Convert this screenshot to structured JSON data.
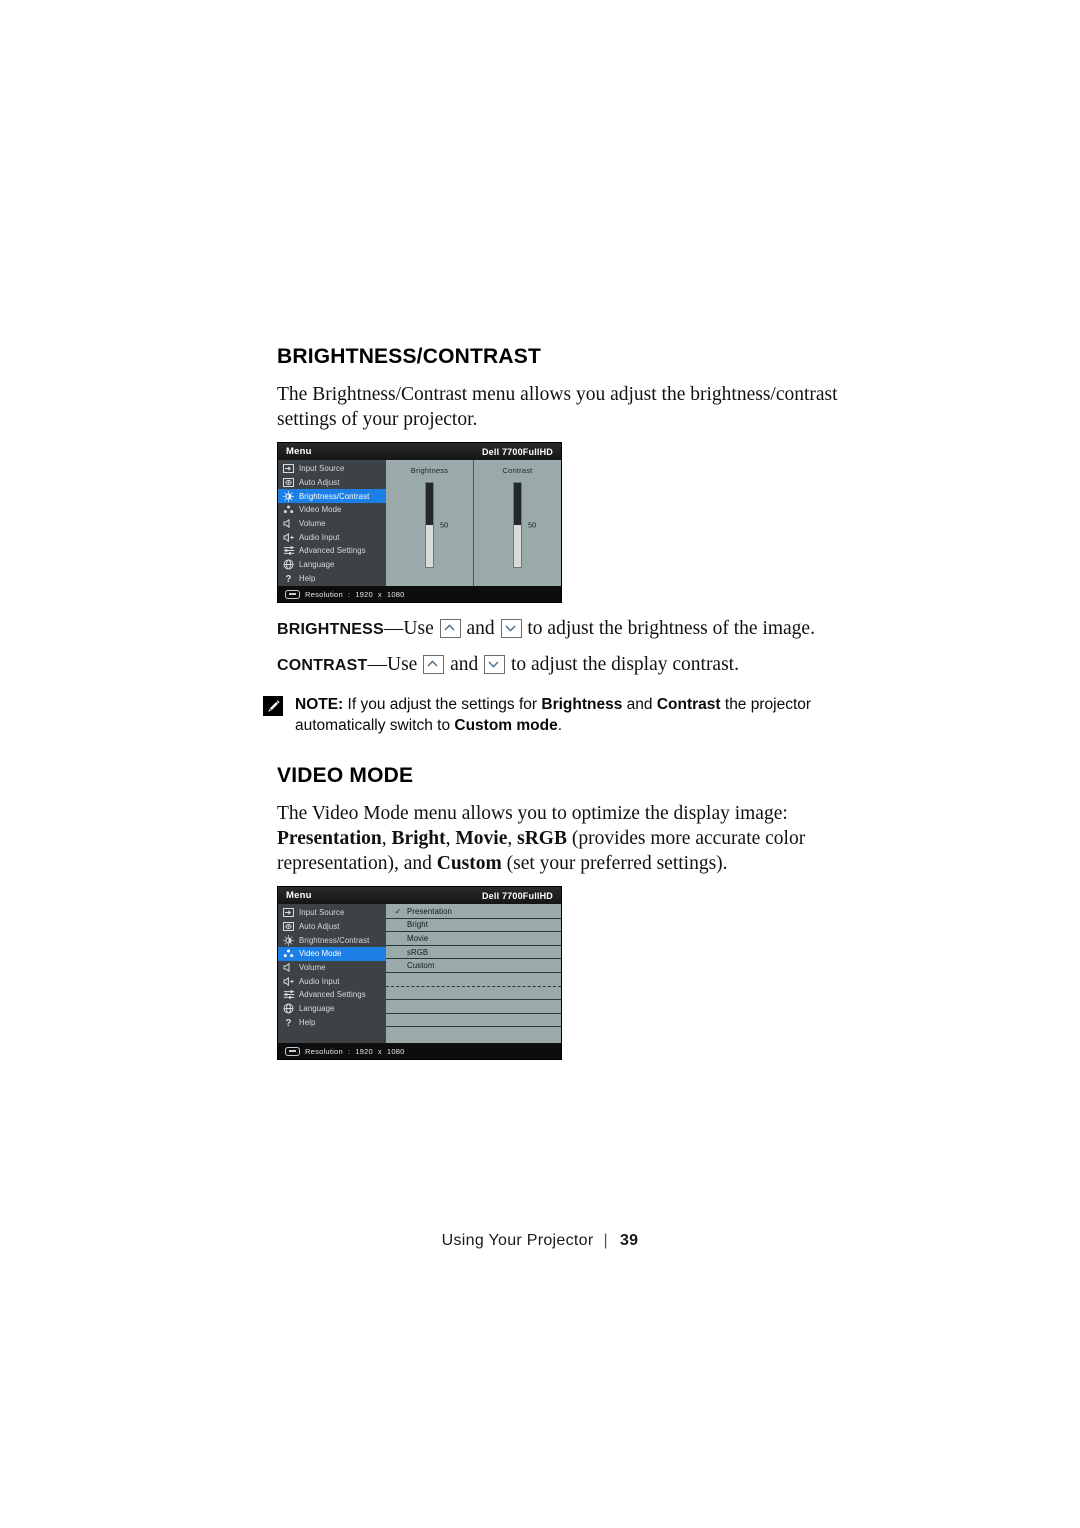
{
  "page": {
    "footer_label": "Using Your Projector",
    "footer_separator": "|",
    "page_number": "39"
  },
  "brightness_contrast": {
    "heading": "BRIGHTNESS/CONTRAST",
    "intro": "The Brightness/Contrast menu allows you adjust the brightness/contrast settings of your projector.",
    "brightness_line_term": "BRIGHTNESS",
    "brightness_line_a": "—Use",
    "brightness_line_b": "and",
    "brightness_line_c": "to adjust the brightness of the image.",
    "contrast_line_term": "CONTRAST",
    "contrast_line_a": "—Use",
    "contrast_line_b": "and",
    "contrast_line_c": "to adjust the display contrast."
  },
  "note": {
    "icon": "pencil-note-icon",
    "label": "NOTE:",
    "text_1": " If you adjust the settings for ",
    "bold_1": "Brightness",
    "text_2": " and ",
    "bold_2": "Contrast",
    "text_3": " the projector automatically switch to ",
    "bold_3": "Custom mode",
    "text_4": "."
  },
  "video_mode": {
    "heading": "VIDEO MODE",
    "intro_plain_1": "The Video Mode menu allows you to optimize the display image: ",
    "intro_bold_1": "Presentation",
    "intro_plain_2": ", ",
    "intro_bold_2": "Bright",
    "intro_plain_3": ", ",
    "intro_bold_3": "Movie",
    "intro_plain_4": ", ",
    "intro_bold_4": "sRGB",
    "intro_plain_5": " (provides more accurate color representation), and ",
    "intro_bold_5": "Custom",
    "intro_plain_6": " (set your preferred settings)."
  },
  "osd": {
    "header": {
      "title": "Menu",
      "model": "Dell 7700FullHD"
    },
    "menu_items": [
      {
        "label": "Input Source",
        "icon": "input-source-icon"
      },
      {
        "label": "Auto Adjust",
        "icon": "auto-adjust-icon"
      },
      {
        "label": "Brightness/Contrast",
        "icon": "brightness-contrast-icon"
      },
      {
        "label": "Video Mode",
        "icon": "video-mode-icon"
      },
      {
        "label": "Volume",
        "icon": "volume-icon"
      },
      {
        "label": "Audio Input",
        "icon": "audio-input-icon"
      },
      {
        "label": "Advanced Settings",
        "icon": "advanced-settings-icon"
      },
      {
        "label": "Language",
        "icon": "language-globe-icon"
      },
      {
        "label": "Help",
        "icon": "help-question-icon"
      }
    ],
    "footer": {
      "resolution_icon": "resolution-icon",
      "label": "Resolution",
      "colon": ":",
      "width": "1920",
      "x": "x",
      "height": "1080"
    },
    "colors": {
      "highlight": "#1b7fe6",
      "sidebar": "#3c4245",
      "panel": "#9aa9a9",
      "header": "#1b1b1b",
      "bar": "#0d0d0d"
    },
    "screen_1": {
      "selected_item": "Brightness/Contrast",
      "sliders": [
        {
          "label": "Brightness",
          "value": "50",
          "percent": 50
        },
        {
          "label": "Contrast",
          "value": "50",
          "percent": 50
        }
      ]
    },
    "screen_2": {
      "selected_item": "Video Mode",
      "modes": [
        {
          "label": "Presentation",
          "checked": true
        },
        {
          "label": "Bright",
          "checked": false
        },
        {
          "label": "Movie",
          "checked": false
        },
        {
          "label": "sRGB",
          "checked": false
        },
        {
          "label": "Custom",
          "checked": false
        },
        {
          "label": "",
          "checked": false
        },
        {
          "label": "",
          "checked": false
        },
        {
          "label": "",
          "checked": false
        },
        {
          "label": "",
          "checked": false
        },
        {
          "label": "",
          "checked": false
        }
      ],
      "check_glyph": "✓"
    }
  }
}
